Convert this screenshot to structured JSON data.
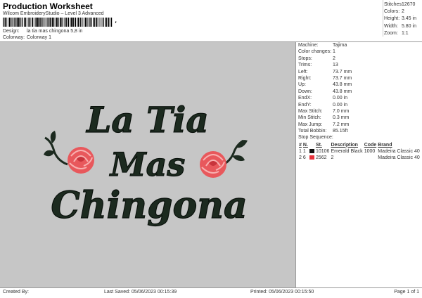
{
  "header": {
    "title": "Production Worksheet",
    "software": "Wilcom EmbroideryStudio – Level 3 Advanced",
    "barcode_text": ",",
    "design_label": "Design:",
    "design_value": "la tia mas chingona 5,8 in",
    "colorway_label": "Colorway:",
    "colorway_value": "Colorway 1"
  },
  "stats": [
    {
      "label": "Stitches:",
      "value": "12670"
    },
    {
      "label": "Colors:",
      "value": "2"
    },
    {
      "label": "Height:",
      "value": "3.45 in"
    },
    {
      "label": "Width:",
      "value": "5.80 in"
    },
    {
      "label": "Zoom:",
      "value": "1:1"
    }
  ],
  "design_text": {
    "line1": "La Tia",
    "line2": "Mas",
    "line3": "Chingona"
  },
  "info": [
    {
      "label": "Machine:",
      "value": "Tajima"
    },
    {
      "label": "Color changes:",
      "value": "1"
    },
    {
      "label": "Stops:",
      "value": "2"
    },
    {
      "label": "Trims:",
      "value": "13"
    },
    {
      "label": "Left:",
      "value": "73.7 mm"
    },
    {
      "label": "Right:",
      "value": "73.7 mm"
    },
    {
      "label": "Up:",
      "value": "43.8 mm"
    },
    {
      "label": "Down:",
      "value": "43.8 mm"
    },
    {
      "label": "EndX:",
      "value": "0.00 in"
    },
    {
      "label": "EndY:",
      "value": "0.00 in"
    },
    {
      "label": "Max Stitch:",
      "value": "7.0 mm"
    },
    {
      "label": "Min Stitch:",
      "value": "0.3 mm"
    },
    {
      "label": "Max Jump:",
      "value": "7.2 mm"
    },
    {
      "label": "Total Bobbin:",
      "value": "85.15ft"
    }
  ],
  "stop_sequence": {
    "title": "Stop Sequence:",
    "columns": [
      "#",
      "N.",
      "",
      "St.",
      "Description",
      "Code",
      "Brand"
    ],
    "rows": [
      {
        "num": "1",
        "n": "1",
        "color": "#111111",
        "st": "10106",
        "description": "Emerald Black",
        "code": "1000",
        "brand": "Madeira Classic 40"
      },
      {
        "num": "2",
        "n": "6",
        "color": "#e8323c",
        "st": "2562",
        "description": "2",
        "code": "",
        "brand": "Madeira Classic 40"
      }
    ]
  },
  "footer": {
    "created_by": "Created By:",
    "last_saved": "Last Saved: 05/06/2023 00:15:39",
    "printed": "Printed: 05/06/2023 00:15:50",
    "page": "Page 1 of 1"
  },
  "colors": {
    "thread_black": "#1c2a1f",
    "rose_red": "#e8585c",
    "canvas_bg": "#c6c6c6"
  }
}
